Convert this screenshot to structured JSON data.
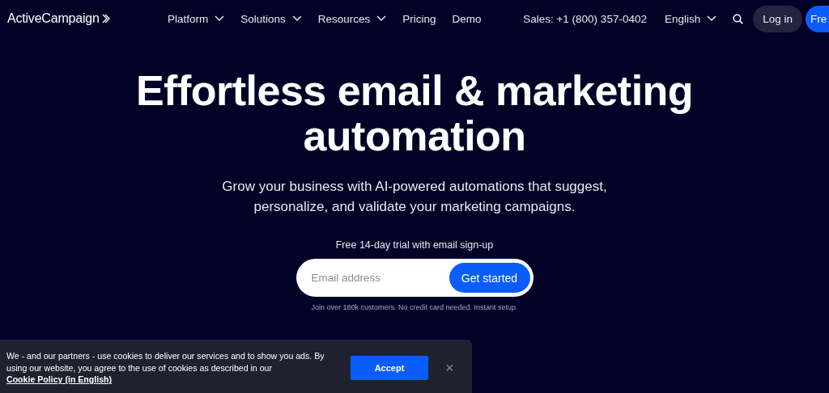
{
  "header": {
    "logo": "ActiveCampaign",
    "nav": [
      {
        "label": "Platform",
        "dropdown": true
      },
      {
        "label": "Solutions",
        "dropdown": true
      },
      {
        "label": "Resources",
        "dropdown": true
      },
      {
        "label": "Pricing",
        "dropdown": false
      },
      {
        "label": "Demo",
        "dropdown": false
      }
    ],
    "sales": "Sales: +1 (800) 357-0402",
    "language": "English",
    "login": "Log in",
    "cta": "Fre"
  },
  "hero": {
    "title": "Effortless email & marketing automation",
    "subtitle": "Grow your business with AI-powered automations that suggest, personalize, and validate your marketing campaigns.",
    "trial": "Free 14-day trial with email sign-up",
    "email": {
      "placeholder": "Email address"
    },
    "submit": "Get started",
    "note": "Join over 180k customers. No credit card needed. Instant setup."
  },
  "cookie_banner": {
    "text": "We - and our partners - use cookies to deliver our services and to show you ads. By using our website, you agree to the use of cookies as described in our",
    "link": "Cookie Policy (in English)",
    "accept": "Accept",
    "close": "×"
  }
}
